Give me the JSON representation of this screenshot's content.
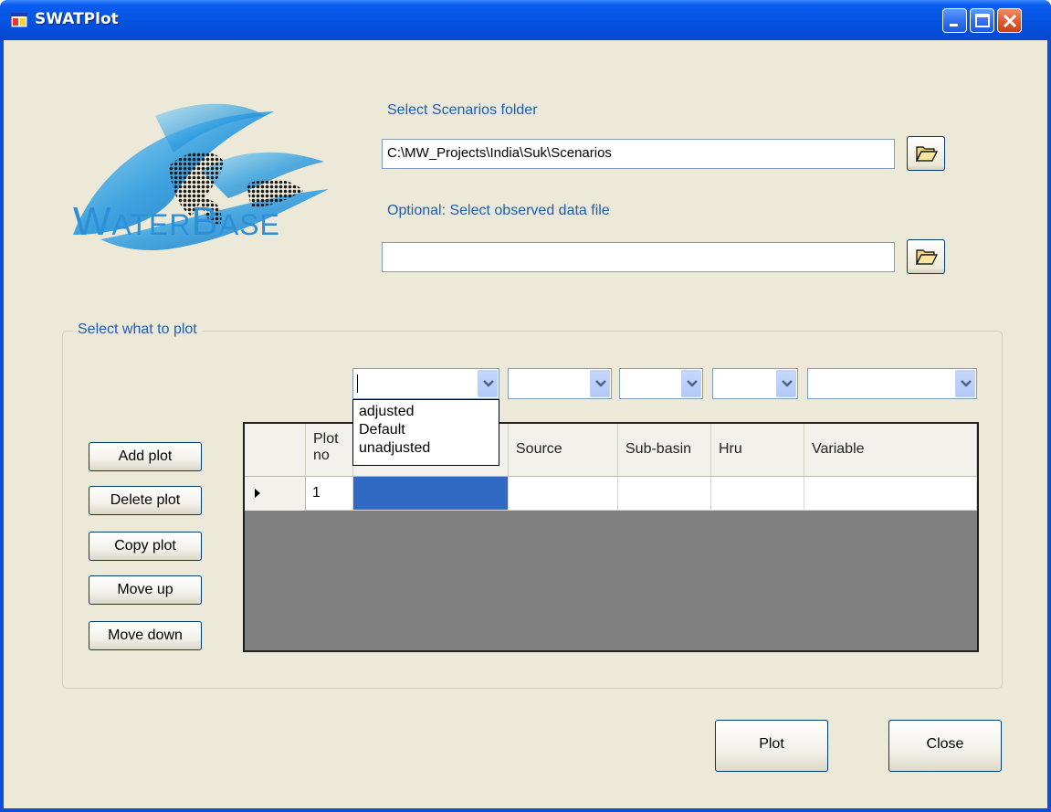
{
  "window": {
    "title": "SWATPlot"
  },
  "logo": {
    "text_big1": "W",
    "text_small1": "ATER",
    "text_big2": "B",
    "text_small2": "ASE"
  },
  "scenarios": {
    "label": "Select Scenarios folder",
    "value": "C:\\MW_Projects\\India\\Suk\\Scenarios"
  },
  "observed": {
    "label": "Optional: Select observed data file",
    "value": ""
  },
  "group": {
    "label": "Select what to plot"
  },
  "buttons": {
    "add_plot": "Add plot",
    "delete_plot": "Delete plot",
    "copy_plot": "Copy plot",
    "move_up": "Move up",
    "move_down": "Move down",
    "plot": "Plot",
    "close": "Close"
  },
  "scenario_combo": {
    "value": "",
    "options": [
      "adjusted",
      "Default",
      "unadjusted"
    ]
  },
  "table": {
    "headers": {
      "plot_no_line1": "Plot",
      "plot_no_line2": "no",
      "source": "Source",
      "subbasin": "Sub-basin",
      "hru": "Hru",
      "variable": "Variable"
    },
    "rows": [
      {
        "plot_no": "1"
      }
    ]
  },
  "colors": {
    "window_blue": "#0a4fd8",
    "client_bg": "#ece9d8",
    "label_blue": "#1d5fb4",
    "selected_cell": "#316ac5",
    "grid_bg": "#808080"
  },
  "icons": {
    "app": "app-window-icon",
    "minimize": "minimize-icon",
    "maximize": "maximize-icon",
    "close": "close-icon",
    "folder": "folder-open-icon",
    "row_pointer": "row-pointer-icon",
    "dropdown": "chevron-down-icon"
  }
}
